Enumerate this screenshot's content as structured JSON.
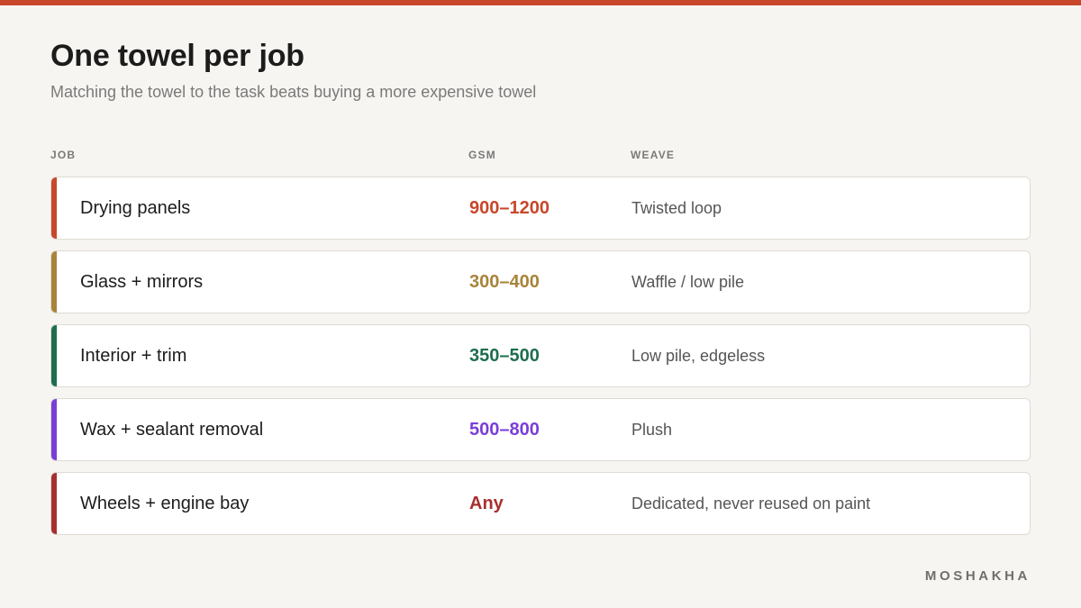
{
  "colors": {
    "accent": "#c8472a",
    "background": "#f7f5f1"
  },
  "header": {
    "title": "One towel per job",
    "subtitle": "Matching the towel to the task beats buying a more expensive towel"
  },
  "table": {
    "columns": {
      "job": "JOB",
      "gsm": "GSM",
      "weave": "WEAVE"
    },
    "rows": [
      {
        "job": "Drying panels",
        "gsm": "900–1200",
        "weave": "Twisted loop",
        "color": "#c8472a"
      },
      {
        "job": "Glass + mirrors",
        "gsm": "300–400",
        "weave": "Waffle / low pile",
        "color": "#a8843a"
      },
      {
        "job": "Interior + trim",
        "gsm": "350–500",
        "weave": "Low pile, edgeless",
        "color": "#1e6e4e"
      },
      {
        "job": "Wax + sealant removal",
        "gsm": "500–800",
        "weave": "Plush",
        "color": "#7a3ed8"
      },
      {
        "job": "Wheels + engine bay",
        "gsm": "Any",
        "weave": "Dedicated, never reused on paint",
        "color": "#a6302e"
      }
    ]
  },
  "footer": {
    "brand": "MOSHAKHA"
  }
}
